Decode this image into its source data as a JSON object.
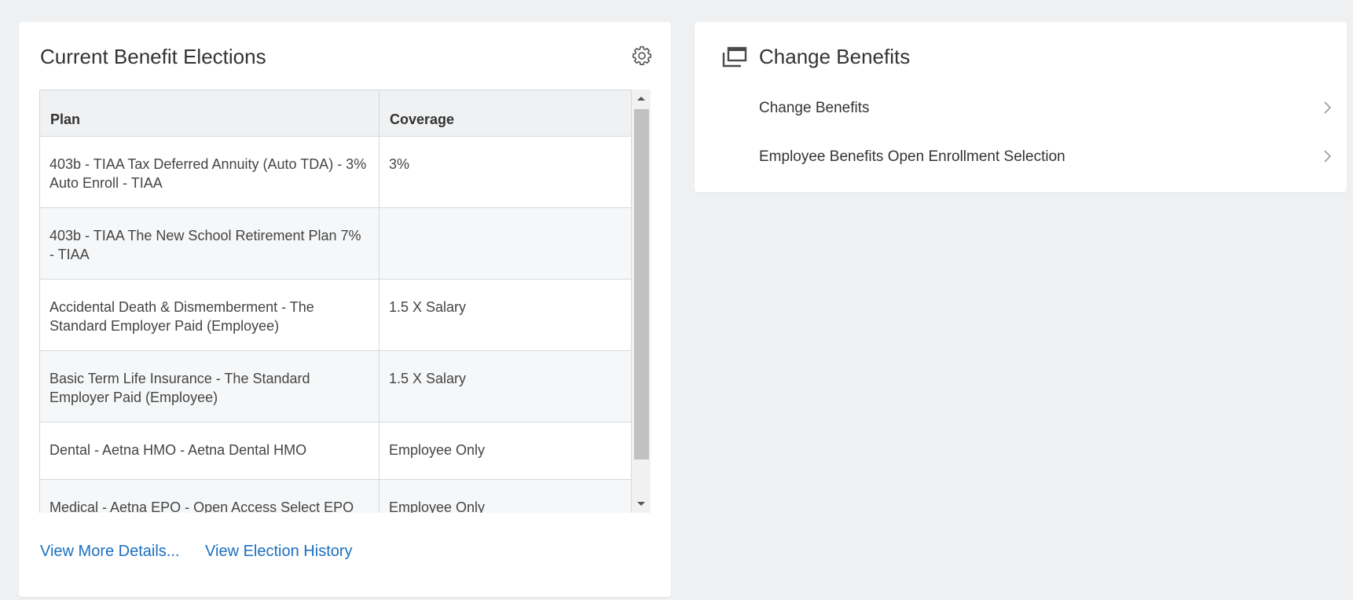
{
  "benefits_card": {
    "title": "Current Benefit Elections",
    "settings_icon": "gear-icon",
    "table": {
      "headers": {
        "plan": "Plan",
        "coverage": "Coverage"
      },
      "rows": [
        {
          "plan": "403b - TIAA Tax Deferred Annuity (Auto TDA) - 3% Auto Enroll - TIAA",
          "coverage": "3%"
        },
        {
          "plan": "403b - TIAA The New School Retirement Plan 7% - TIAA",
          "coverage": ""
        },
        {
          "plan": "Accidental Death & Dismemberment - The Standard Employer Paid (Employee)",
          "coverage": "1.5 X Salary"
        },
        {
          "plan": "Basic Term Life Insurance - The Standard Employer Paid (Employee)",
          "coverage": "1.5 X Salary"
        },
        {
          "plan": "Dental - Aetna HMO - Aetna Dental HMO",
          "coverage": "Employee Only"
        },
        {
          "plan": "Medical - Aetna EPO - Open Access Select EPO",
          "coverage": "Employee Only"
        }
      ]
    },
    "links": {
      "view_more": "View More Details...",
      "view_history": "View Election History"
    }
  },
  "change_card": {
    "title": "Change Benefits",
    "icon": "windows-stack-icon",
    "tasks": [
      {
        "label": "Change Benefits"
      },
      {
        "label": "Employee Benefits Open Enrollment Selection"
      }
    ]
  },
  "colors": {
    "background": "#eef0f2",
    "card": "#ffffff",
    "link": "#1a6fbf",
    "header_row": "#f0f1f2",
    "alt_row": "#f6f7f8",
    "border": "#d6d8db"
  }
}
